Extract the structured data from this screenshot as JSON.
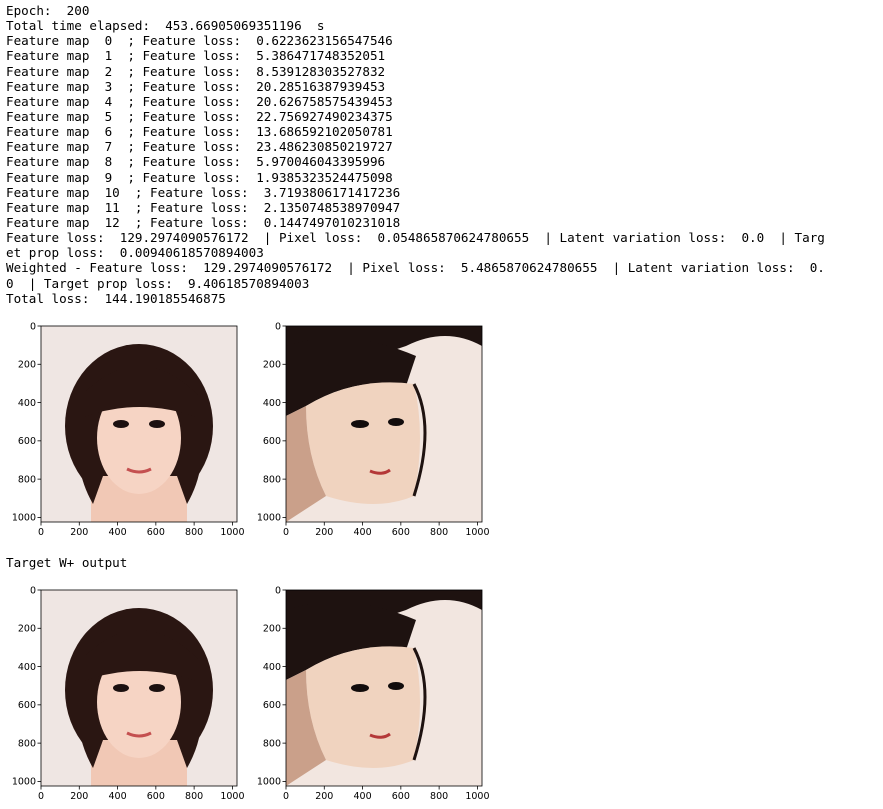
{
  "output": {
    "log_lines": [
      "Epoch:  200",
      "Total time elapsed:  453.66905069351196  s",
      "Feature map  0  ; Feature loss:  0.6223623156547546",
      "Feature map  1  ; Feature loss:  5.386471748352051",
      "Feature map  2  ; Feature loss:  8.539128303527832",
      "Feature map  3  ; Feature loss:  20.28516387939453",
      "Feature map  4  ; Feature loss:  20.626758575439453",
      "Feature map  5  ; Feature loss:  22.756927490234375",
      "Feature map  6  ; Feature loss:  13.686592102050781",
      "Feature map  7  ; Feature loss:  23.486230850219727",
      "Feature map  8  ; Feature loss:  5.970046043395996",
      "Feature map  9  ; Feature loss:  1.9385323524475098",
      "Feature map  10  ; Feature loss:  3.7193806171417236",
      "Feature map  11  ; Feature loss:  2.1350748538970947",
      "Feature map  12  ; Feature loss:  0.1447497010231018",
      "Feature loss:  129.2974090576172  | Pixel loss:  0.054865870624780655  | Latent variation loss:  0.0  | Targ",
      "et prop loss:  0.00940618570894003",
      "Weighted - Feature loss:  129.2974090576172  | Pixel loss:  5.4865870624780655  | Latent variation loss:  0.",
      "0  | Target prop loss:  9.40618570894003",
      "Total loss:  144.190185546875"
    ],
    "caption": "Target W+ output"
  },
  "axes": {
    "y_ticks": [
      "0",
      "200",
      "400",
      "600",
      "800",
      "1000"
    ],
    "x_ticks": [
      "0",
      "200",
      "400",
      "600",
      "800",
      "1000"
    ]
  },
  "images": [
    {
      "subject": "front-facing portrait, bob haircut"
    },
    {
      "subject": "three-quarter portrait, bob haircut, high contrast"
    },
    {
      "subject": "front-facing portrait, bob haircut"
    },
    {
      "subject": "three-quarter portrait, bob haircut, high contrast"
    }
  ]
}
